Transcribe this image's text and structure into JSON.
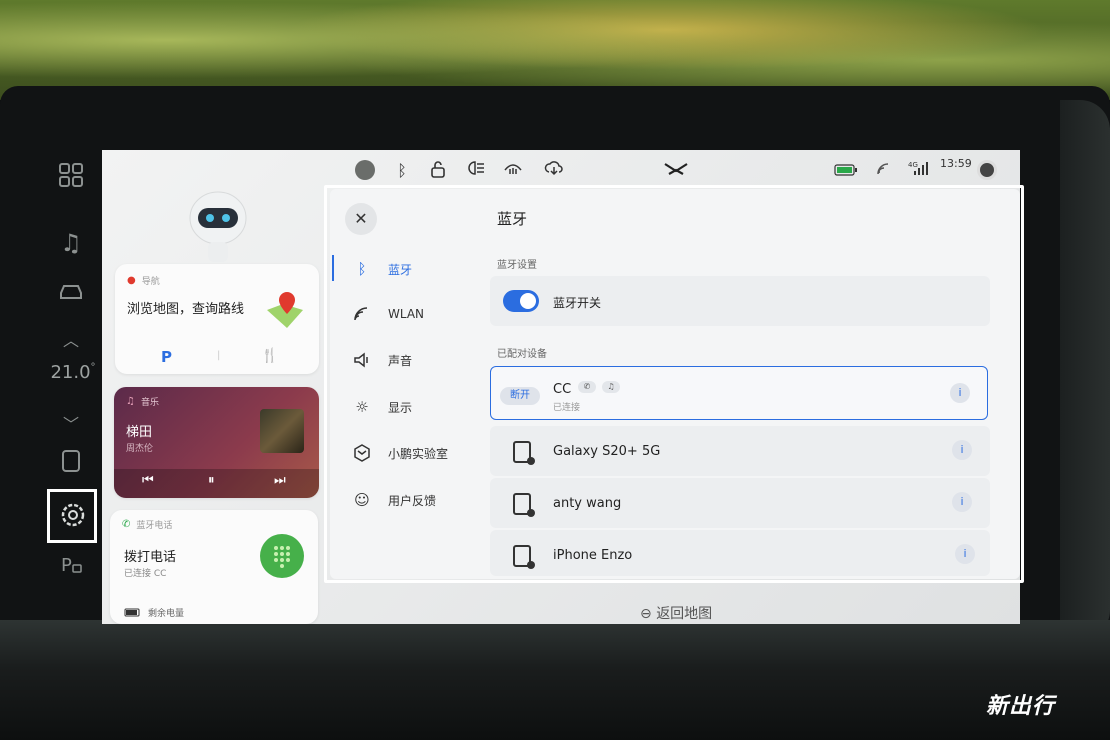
{
  "status_bar": {
    "time": "13:59",
    "signal": "4G",
    "icons": [
      "avatar-icon",
      "bluetooth-icon",
      "lock-icon",
      "headlight-icon",
      "defrost-icon",
      "cloud-download-icon",
      "xpeng-logo",
      "battery-icon",
      "wifi-icon",
      "signal-icon",
      "user-icon"
    ],
    "battery_color": "#2aa84a"
  },
  "left_rail": {
    "temperature": "21.0",
    "temp_unit": "°",
    "icons": [
      "apps-icon",
      "music-icon",
      "car-icon",
      "chevron-up-icon",
      "chevron-down-icon",
      "phone-icon",
      "settings-icon",
      "parking-icon"
    ]
  },
  "cards": {
    "nav": {
      "label": "导航",
      "title": "浏览地图，查询路线",
      "parking": "P",
      "divider": "|"
    },
    "music": {
      "label": "音乐",
      "song": "梯田",
      "artist": "周杰伦"
    },
    "phone": {
      "label": "蓝牙电话",
      "title": "拨打电话",
      "status": "已连接 CC",
      "battery_label": "剩余电量"
    }
  },
  "settings": {
    "title": "蓝牙",
    "menu": [
      {
        "label": "蓝牙",
        "icon": "bluetooth-icon",
        "active": true
      },
      {
        "label": "WLAN",
        "icon": "wifi-icon",
        "active": false
      },
      {
        "label": "声音",
        "icon": "speaker-icon",
        "active": false
      },
      {
        "label": "显示",
        "icon": "brightness-icon",
        "active": false
      },
      {
        "label": "小鹏实验室",
        "icon": "lab-icon",
        "active": false
      },
      {
        "label": "用户反馈",
        "icon": "smile-icon",
        "active": false
      }
    ],
    "bt_settings_label": "蓝牙设置",
    "bt_switch_label": "蓝牙开关",
    "bt_switch_on": true,
    "paired_label": "已配对设备",
    "connected_device": {
      "name": "CC",
      "status": "已连接",
      "action": "断开"
    },
    "devices": [
      {
        "name": "Galaxy S20+ 5G"
      },
      {
        "name": "anty wang"
      },
      {
        "name": "iPhone Enzo"
      }
    ],
    "accent": "#2b6de0"
  },
  "back_map": "返回地图",
  "watermark": "新出行"
}
